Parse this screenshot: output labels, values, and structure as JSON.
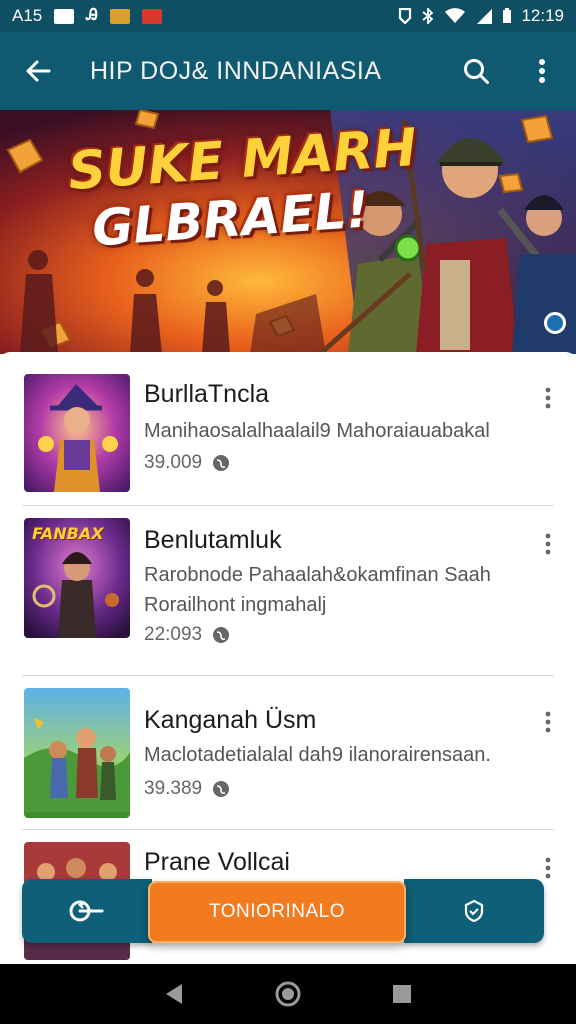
{
  "status_bar": {
    "time": "A15",
    "clock": "12:19",
    "colors": {
      "notif_1": "#ffffff",
      "notif_2": "#d8a030",
      "notif_3": "#d63a2a"
    }
  },
  "app_bar": {
    "title": "HIP DOJ& INNDANIASIA",
    "back_icon": "arrow-left-icon",
    "search_icon": "search-icon",
    "menu_icon": "more-vertical-icon"
  },
  "banner": {
    "headline_1": "SUKE MARH",
    "headline_2": "GLBRAEL!"
  },
  "games": [
    {
      "title": "BurllaTncla",
      "desc_1": "Manihaosalalhaalail9 Mahoraiauabakal",
      "desc_2": "",
      "count": "39.009"
    },
    {
      "title": "Benlutamluk",
      "desc_1": "Rarobnode Pahaalah&okamfinan Saah",
      "desc_2": "Rorailhont ingmahalj",
      "count": "22:093",
      "thumb_label": "FANBAX"
    },
    {
      "title": "Kanganah Üsm",
      "desc_1": "Maclotadetialalal dah9 ilanorairensaan.",
      "desc_2": "",
      "count": "39.389"
    },
    {
      "title": "Prane Vollcai",
      "desc_1": "",
      "desc_2": "",
      "count": ""
    }
  ],
  "bottom_bar": {
    "center_label": "TONIORINALO",
    "left_icon": "refresh-key-icon",
    "right_icon": "shield-icon"
  },
  "colors": {
    "primary": "#0f5a70",
    "accent": "#f27a1f"
  }
}
